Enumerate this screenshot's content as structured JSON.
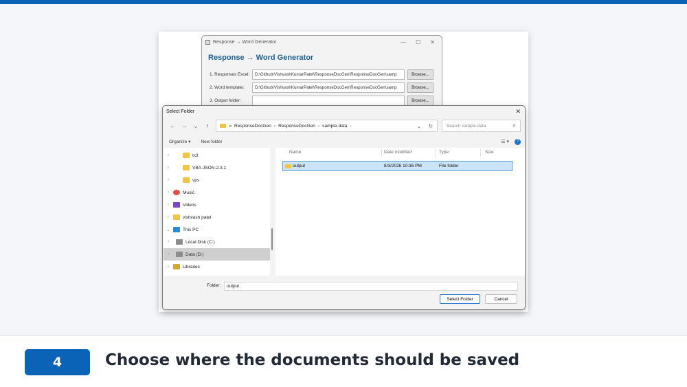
{
  "app": {
    "window_title": "Response → Word Generator",
    "heading": "Response → Word Generator",
    "rows": [
      {
        "label": "1. Responses Excel:",
        "value": "D:\\Github\\VishvashKumarPatel\\ResponseDocGen\\ResponseDocGen\\samp",
        "button": "Browse..."
      },
      {
        "label": "2. Word template:",
        "value": "D:\\Github\\VishvashKumarPatel\\ResponseDocGen\\ResponseDocGen\\samp",
        "button": "Browse..."
      },
      {
        "label": "3. Output folder:",
        "value": "",
        "button": "Browse..."
      }
    ]
  },
  "dialog": {
    "title": "Select Folder",
    "breadcrumb": [
      "«",
      "ResponseDocGen",
      "ResponseDocGen",
      "sample-data"
    ],
    "search_placeholder": "Search sample-data",
    "organize_label": "Organize ▾",
    "new_folder_label": "New folder",
    "nav_items": [
      {
        "label": "tx3",
        "icon": "folder-icon",
        "selected": false
      },
      {
        "label": "VBA-JSON-2.3.1",
        "icon": "folder-icon",
        "selected": false
      },
      {
        "label": "vps",
        "icon": "folder-icon",
        "selected": false
      },
      {
        "label": "Music",
        "icon": "music-icon",
        "selected": false
      },
      {
        "label": "Videos",
        "icon": "video-icon",
        "selected": false
      },
      {
        "label": "vishvash patel",
        "icon": "folder-icon",
        "selected": false
      },
      {
        "label": "This PC",
        "icon": "computer-icon",
        "selected": false
      },
      {
        "label": "Local Disk (C:)",
        "icon": "disk-icon",
        "selected": false
      },
      {
        "label": "Data (D:)",
        "icon": "disk-icon",
        "selected": true
      },
      {
        "label": "Libraries",
        "icon": "library-icon",
        "selected": false
      }
    ],
    "columns": [
      "Name",
      "Date modified",
      "Type",
      "Size"
    ],
    "files": [
      {
        "name": "output",
        "date": "8/3/2026 10:36 PM",
        "type": "File folder",
        "size": ""
      }
    ],
    "folder_label": "Folder:",
    "folder_value": "output",
    "select_button": "Select Folder",
    "cancel_button": "Cancel"
  },
  "step": {
    "number": "4",
    "caption": "Choose where the documents should be saved"
  },
  "colors": {
    "accent": "#0b63b8",
    "selection": "#cce4f7"
  }
}
